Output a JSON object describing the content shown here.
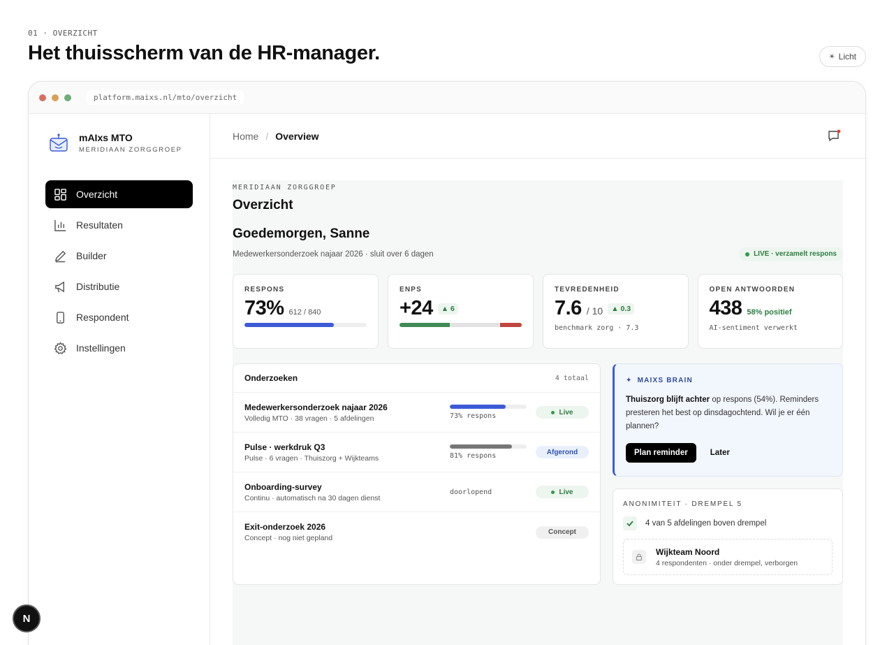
{
  "page": {
    "eyebrow": "01 · OVERZICHT",
    "title": "Het thuisscherm van de HR-manager.",
    "theme_toggle": "Licht"
  },
  "browser": {
    "url": "platform.maixs.nl/mto/overzicht",
    "dots": [
      "#d9705f",
      "#d9a05a",
      "#6fae7a"
    ]
  },
  "sidebar": {
    "brand_name": "mAIxs MTO",
    "brand_org": "MERIDIAAN ZORGGROEP",
    "items": [
      {
        "label": "Overzicht",
        "icon": "grid-icon",
        "active": true
      },
      {
        "label": "Resultaten",
        "icon": "bar-chart-icon",
        "active": false
      },
      {
        "label": "Builder",
        "icon": "pen-icon",
        "active": false
      },
      {
        "label": "Distributie",
        "icon": "megaphone-icon",
        "active": false
      },
      {
        "label": "Respondent",
        "icon": "phone-icon",
        "active": false
      },
      {
        "label": "Instellingen",
        "icon": "gear-icon",
        "active": false
      }
    ]
  },
  "topbar": {
    "crumb_home": "Home",
    "crumb_sep": "/",
    "crumb_current": "Overview",
    "chat_icon": "chat-notification-icon"
  },
  "header": {
    "org": "MERIDIAAN ZORGGROEP",
    "title": "Overzicht",
    "greeting": "Goedemorgen, Sanne",
    "subtitle": "Medewerkersonderzoek najaar 2026 · sluit over 6 dagen",
    "live_pill": "LIVE · verzamelt respons"
  },
  "kpis": {
    "respons": {
      "label": "RESPONS",
      "value": "73%",
      "aux": "612 / 840",
      "progress": 0.73,
      "color": "#3b5bd6"
    },
    "enps": {
      "label": "ENPS",
      "value": "+24",
      "delta": "▲ 6",
      "promoters": 0.41,
      "passives": 0.41,
      "detractors": 0.18,
      "colors": [
        "#3f8a55",
        "#e2e2e2",
        "#c0463f"
      ]
    },
    "tevredenheid": {
      "label": "TEVREDENHEID",
      "value": "7.6",
      "aux": "/ 10",
      "delta": "▲ 0.3",
      "note": "benchmark zorg · 7.3"
    },
    "open": {
      "label": "OPEN ANTWOORDEN",
      "value": "438",
      "positive": "58% positief",
      "note": "AI-sentiment verwerkt"
    }
  },
  "surveys": {
    "title": "Onderzoeken",
    "count": "4 totaal",
    "rows": [
      {
        "name": "Medewerkersonderzoek najaar 2026",
        "meta": "Volledig MTO · 38 vragen · 5 afdelingen",
        "progress": 0.73,
        "bar_color": "#3b5bd6",
        "progress_text": "73% respons",
        "status": "Live",
        "status_type": "live"
      },
      {
        "name": "Pulse · werkdruk Q3",
        "meta": "Pulse · 6 vragen · Thuiszorg + Wijkteams",
        "progress": 0.81,
        "bar_color": "#777777",
        "progress_text": "81% respons",
        "status": "Afgerond",
        "status_type": "done"
      },
      {
        "name": "Onboarding-survey",
        "meta": "Continu · automatisch na 30 dagen dienst",
        "progress": null,
        "progress_text": "doorlopend",
        "status": "Live",
        "status_type": "live"
      },
      {
        "name": "Exit-onderzoek 2026",
        "meta": "Concept · nog niet gepland",
        "progress": null,
        "progress_text": "",
        "status": "Concept",
        "status_type": "concept"
      }
    ]
  },
  "brain": {
    "title": "MAIXS BRAIN",
    "highlight": "Thuiszorg blijft achter",
    "text": " op respons (54%). Reminders presteren het best op dinsdagochtend. Wil je er één plannen?",
    "primary": "Plan reminder",
    "secondary": "Later"
  },
  "anon": {
    "title": "ANONIMITEIT · DREMPEL 5",
    "check_text": "4 van 5 afdelingen boven drempel",
    "team_name": "Wijkteam Noord",
    "team_meta": "4 respondenten · onder drempel, verborgen"
  },
  "next_badge": "N"
}
